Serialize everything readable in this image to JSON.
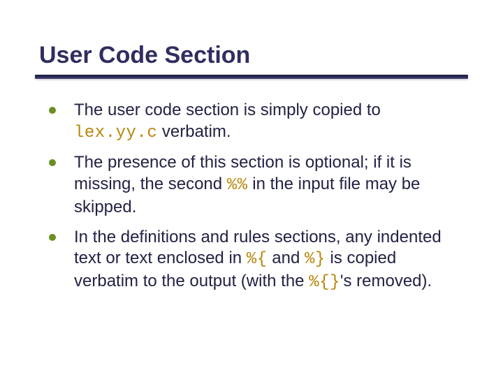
{
  "title": "User Code Section",
  "bullets": {
    "b1": {
      "pre": "The user code section is simply copied to ",
      "code1": "lex.yy.c",
      "post": " verbatim."
    },
    "b2": {
      "pre": "The presence of this section is optional; if it is missing, the second ",
      "code1": "%%",
      "post": " in the input file may be skipped."
    },
    "b3": {
      "t1": "In the definitions and rules sections, any indented text or text enclosed in ",
      "c1": "%{",
      "t2": " and ",
      "c2": "%}",
      "t3": " is copied verbatim to the output (with the ",
      "c3": "%{}",
      "t4": "'s removed)."
    }
  }
}
